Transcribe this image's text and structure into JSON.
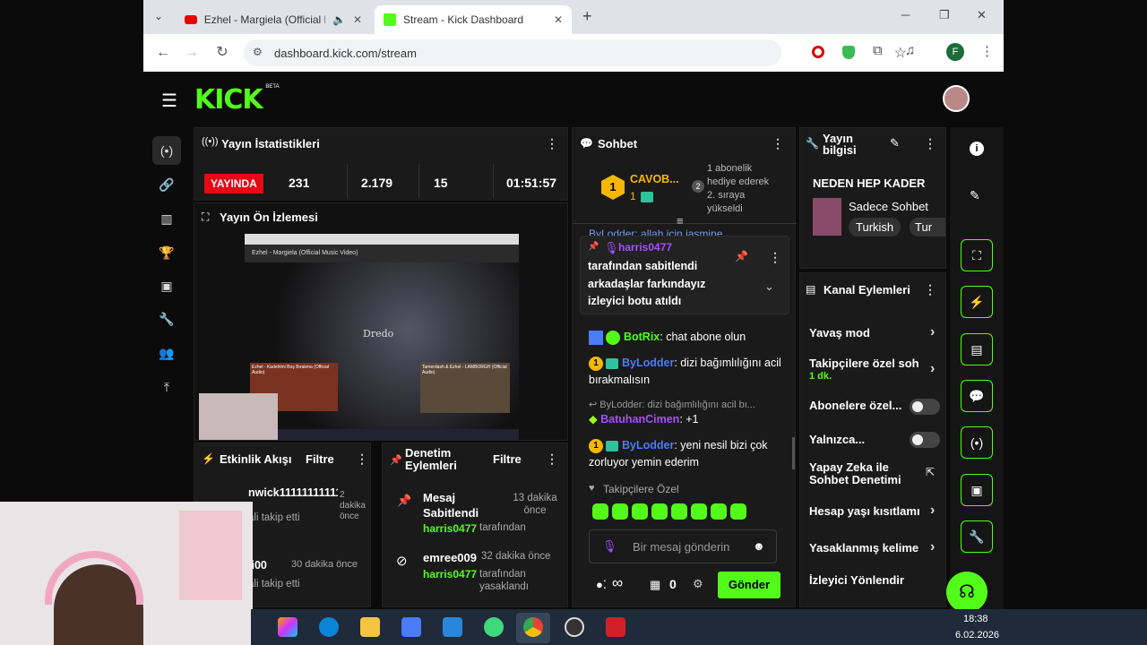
{
  "browser": {
    "tabs": [
      {
        "title": "Ezhel - Margiela (Official M"
      },
      {
        "title": "Stream - Kick Dashboard"
      }
    ],
    "url": "dashboard.kick.com/stream",
    "new_tab": "+",
    "profile_initial": "F"
  },
  "logo": {
    "text": "KICK",
    "beta": "BETA"
  },
  "stats": {
    "title": "Yayın İstatistikleri",
    "live": "YAYINDA",
    "viewers": "231",
    "followers": "2.179",
    "subs": "15",
    "uptime": "01:51:57"
  },
  "preview": {
    "title": "Yayın Ön İzlemesi",
    "video_title": "Ezhel - Margiela (Official Music Video)",
    "thumb1": "Ezhel - Kadehimi Boş Bırakma (Official Audio)",
    "thumb2": "Tamerdash & Ezhel - LAMBORGH (Official Audio)",
    "watermark": "Dredo"
  },
  "activity": {
    "title": "Etkinlik Akışı",
    "filter": "Filtre",
    "items": [
      {
        "name": "nwick11111111111",
        "time": "2 dakika önce",
        "action": "ali takip etti"
      },
      {
        "name": "li00",
        "time": "30 dakika önce",
        "action": "ali takip etti"
      }
    ]
  },
  "moderation": {
    "title": "Denetim Eylemleri",
    "filter": "Filtre",
    "items": [
      {
        "action": "Mesaj Sabitlendi",
        "time": "13 dakika önce",
        "by": "harris0477",
        "suffix": "tarafından"
      },
      {
        "action": "emree009",
        "time": "32 dakika önce",
        "by": "harris0477",
        "suffix": "tarafından yasaklandı"
      }
    ]
  },
  "chat": {
    "title": "Sohbet",
    "top_user": "CAVOB...",
    "top_count": "1",
    "gift_note": "1 abonelik hediye ederek 2. sıraya yükseldi",
    "partial_line": "ByLodder: allah için jasmine",
    "pinned": {
      "user": "harris0477",
      "by": "tarafından sabitlendi",
      "text": "arkadaşlar farkındayız izleyici botu atıldı"
    },
    "messages": [
      {
        "user": "BotRix",
        "text": ": chat abone olun",
        "color": "#53fc18"
      },
      {
        "user": "ByLodder",
        "text": ": dizi bağımlılığını acil bırakmalısın",
        "color": "#4a7cf6"
      },
      {
        "reply": "ByLodder: dizi bağımlılığını acil bı..."
      },
      {
        "user": "BatuhanCimen",
        "text": ": +1",
        "color": "#a64dff"
      },
      {
        "user": "ByLodder",
        "text": ": yeni nesil bizi çok zorluyor yemin ederim",
        "color": "#4a7cf6"
      }
    ],
    "mode": "Takipçilere Özel",
    "placeholder": "Bir mesaj gönderin",
    "count": "0",
    "send": "Gönder",
    "infinity": "∞"
  },
  "info": {
    "title": "Yayın bilgisi",
    "stream_title": "NEDEN HEP KADER",
    "category": "Sadece Sohbet",
    "tags": [
      "Turkish",
      "Tur"
    ]
  },
  "channel_actions": {
    "title": "Kanal Eylemleri",
    "items": [
      {
        "label": "Yavaş mod"
      },
      {
        "label": "Takipçilere özel soh",
        "sub": "1 dk."
      },
      {
        "label": "Abonelere özel..."
      },
      {
        "label": "Yalnızca..."
      },
      {
        "label": "Yapay Zeka ile Sohbet Denetimi"
      },
      {
        "label": "Hesap yaşı kısıtlamı"
      },
      {
        "label": "Yasaklanmış kelime"
      },
      {
        "label": "İzleyici Yönlendir"
      }
    ]
  },
  "taskbar": {
    "time": "18:38",
    "date": "6.02.2026"
  },
  "colors": {
    "accent": "#53fc18",
    "live": "#e50914",
    "panel": "#1a1a1a"
  }
}
